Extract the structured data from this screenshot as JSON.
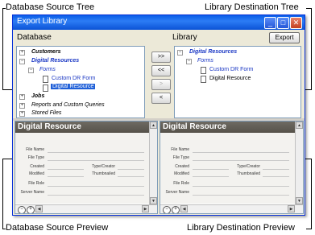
{
  "callouts": {
    "db_source_tree": "Database Source Tree",
    "lib_dest_tree": "Library Destination Tree",
    "db_source_preview": "Database Source Preview",
    "lib_dest_preview": "Library Destination Preview"
  },
  "window": {
    "title": "Export Library",
    "controls": {
      "minimize": "_",
      "maximize": "□",
      "close": "✕"
    }
  },
  "left_pane": {
    "header": "Database",
    "tree": [
      {
        "label": "Customers",
        "expander": "+"
      },
      {
        "label": "Digital Resources",
        "expander": "−"
      },
      {
        "label": "Forms",
        "expander": "−"
      },
      {
        "label": "Custom DR Form"
      },
      {
        "label": "Digital Resource",
        "selected": true
      },
      {
        "label": "Jobs",
        "expander": "+"
      },
      {
        "label": "Reports and Custom Queries",
        "expander": "+"
      },
      {
        "label": "Stored Files",
        "expander": "+"
      }
    ]
  },
  "right_pane": {
    "header": "Library",
    "export_label": "Export",
    "tree": [
      {
        "label": "Digital Resources",
        "expander": "−"
      },
      {
        "label": "Forms",
        "expander": "−"
      },
      {
        "label": "Custom DR Form"
      },
      {
        "label": "Digital Resource"
      }
    ]
  },
  "move_buttons": [
    ">>",
    "<<",
    ">",
    "<"
  ],
  "left_preview": {
    "title": "Digital Resource",
    "fields": [
      "File Name",
      "File Type",
      "Created",
      "Modified",
      "File Role",
      "Server Name"
    ],
    "right_fields": [
      "Type/Creator",
      "Thumbnailed"
    ]
  },
  "right_preview": {
    "title": "Digital Resource",
    "fields": [
      "File Name",
      "File Type",
      "Created",
      "Modified",
      "File Role",
      "Server Name"
    ],
    "right_fields": [
      "Type/Creator",
      "Thumbnailed"
    ]
  },
  "icons": [
    "minimize-icon",
    "maximize-icon",
    "close-icon",
    "zoom-out-icon",
    "zoom-in-icon",
    "document-icon",
    "arrow-left-icon",
    "arrow-right-icon"
  ]
}
